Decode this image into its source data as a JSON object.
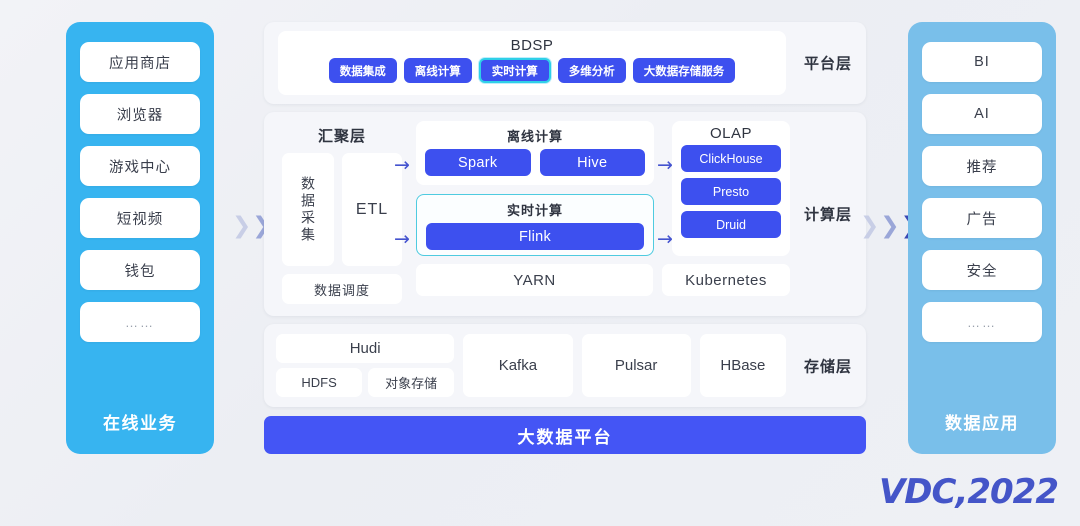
{
  "left_column": {
    "title": "在线业务",
    "items": [
      "应用商店",
      "浏览器",
      "游戏中心",
      "短视频",
      "钱包",
      "……"
    ]
  },
  "right_column": {
    "title": "数据应用",
    "items": [
      "BI",
      "AI",
      "推荐",
      "广告",
      "安全",
      "……"
    ]
  },
  "flow_arrow": {
    "glyph": "❯"
  },
  "mini_arrow": {
    "glyph": "→"
  },
  "platform_layer": {
    "layer_label": "平台层",
    "title": "BDSP",
    "chips": [
      "数据集成",
      "离线计算",
      "实时计算",
      "多维分析",
      "大数据存储服务"
    ],
    "active_chip": "实时计算"
  },
  "compute_layer": {
    "layer_label": "计算层",
    "aggregation": {
      "title": "汇聚层",
      "collect": "数据采集",
      "etl": "ETL",
      "schedule": "数据调度"
    },
    "offline": {
      "title": "离线计算",
      "items": [
        "Spark",
        "Hive"
      ]
    },
    "realtime": {
      "title": "实时计算",
      "items": [
        "Flink"
      ]
    },
    "olap": {
      "title": "OLAP",
      "items": [
        "ClickHouse",
        "Presto",
        "Druid"
      ]
    },
    "resources": [
      "YARN",
      "Kubernetes"
    ]
  },
  "storage_layer": {
    "layer_label": "存储层",
    "hudi": "Hudi",
    "hudi_sub": [
      "HDFS",
      "对象存储"
    ],
    "stores": [
      "Kafka",
      "Pulsar",
      "HBase"
    ]
  },
  "bottom_banner": {
    "label": "大数据平台"
  },
  "logo": {
    "mark": "VDC,",
    "year": "2022"
  },
  "colors": {
    "brand_blue": "#3d50ef",
    "banner_blue": "#4455f5",
    "left_cyan": "#37b4f0",
    "right_blue": "#79bfea",
    "highlight_teal": "#4ecbe0",
    "background": "#eef0f4"
  }
}
